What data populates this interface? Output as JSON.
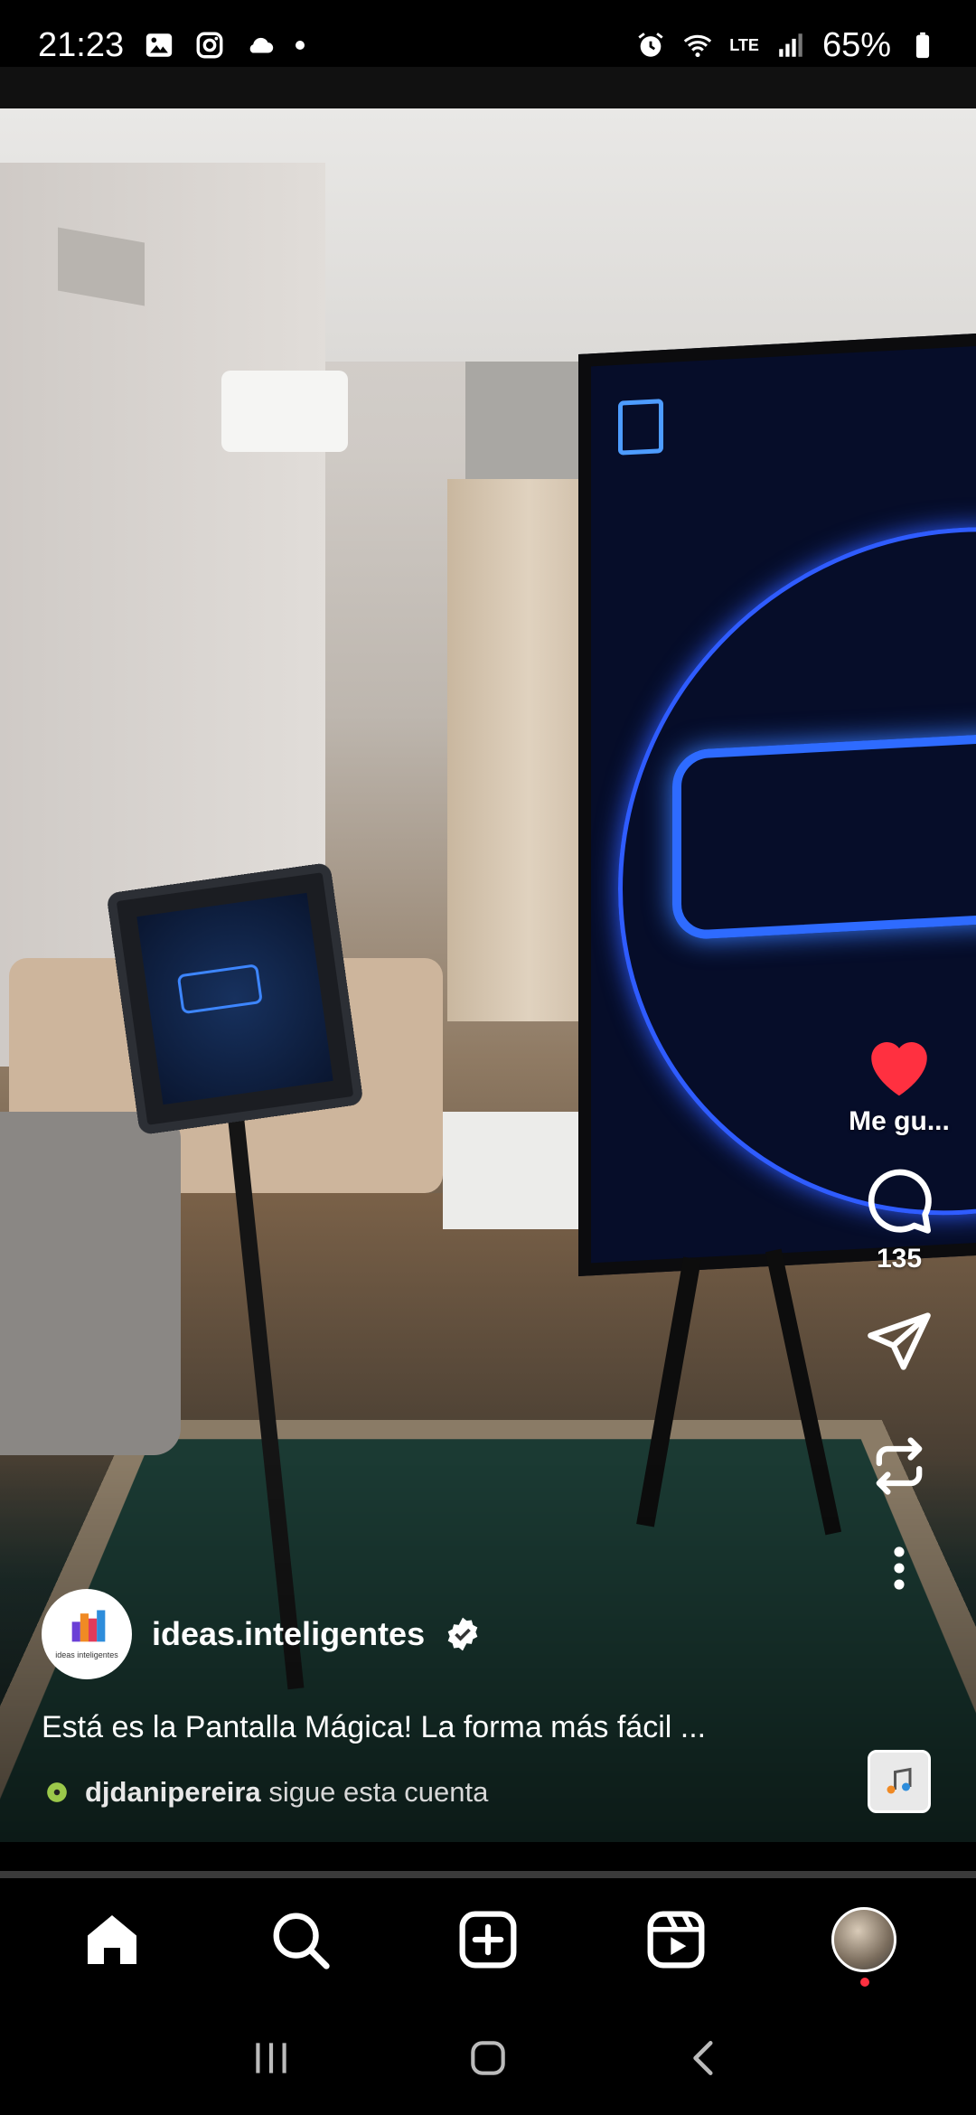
{
  "status_bar": {
    "time": "21:23",
    "battery": "65%",
    "network_label": "LTE"
  },
  "post": {
    "author": "ideas.inteligentes",
    "verified": true,
    "avatar_text": "ideas inteligentes",
    "caption": "Está es la Pantalla Mágica! La forma más fácil ...",
    "follower_name": "djdanipereira",
    "follower_suffix": "sigue esta cuenta"
  },
  "actions": {
    "like_label": "Me gu...",
    "comment_count": "135"
  },
  "progress": 0.0,
  "colors": {
    "like_red": "#ff3040",
    "background": "#000000"
  },
  "nav": {
    "items": [
      "home-icon",
      "search-icon",
      "create-icon",
      "reels-icon",
      "profile"
    ]
  }
}
